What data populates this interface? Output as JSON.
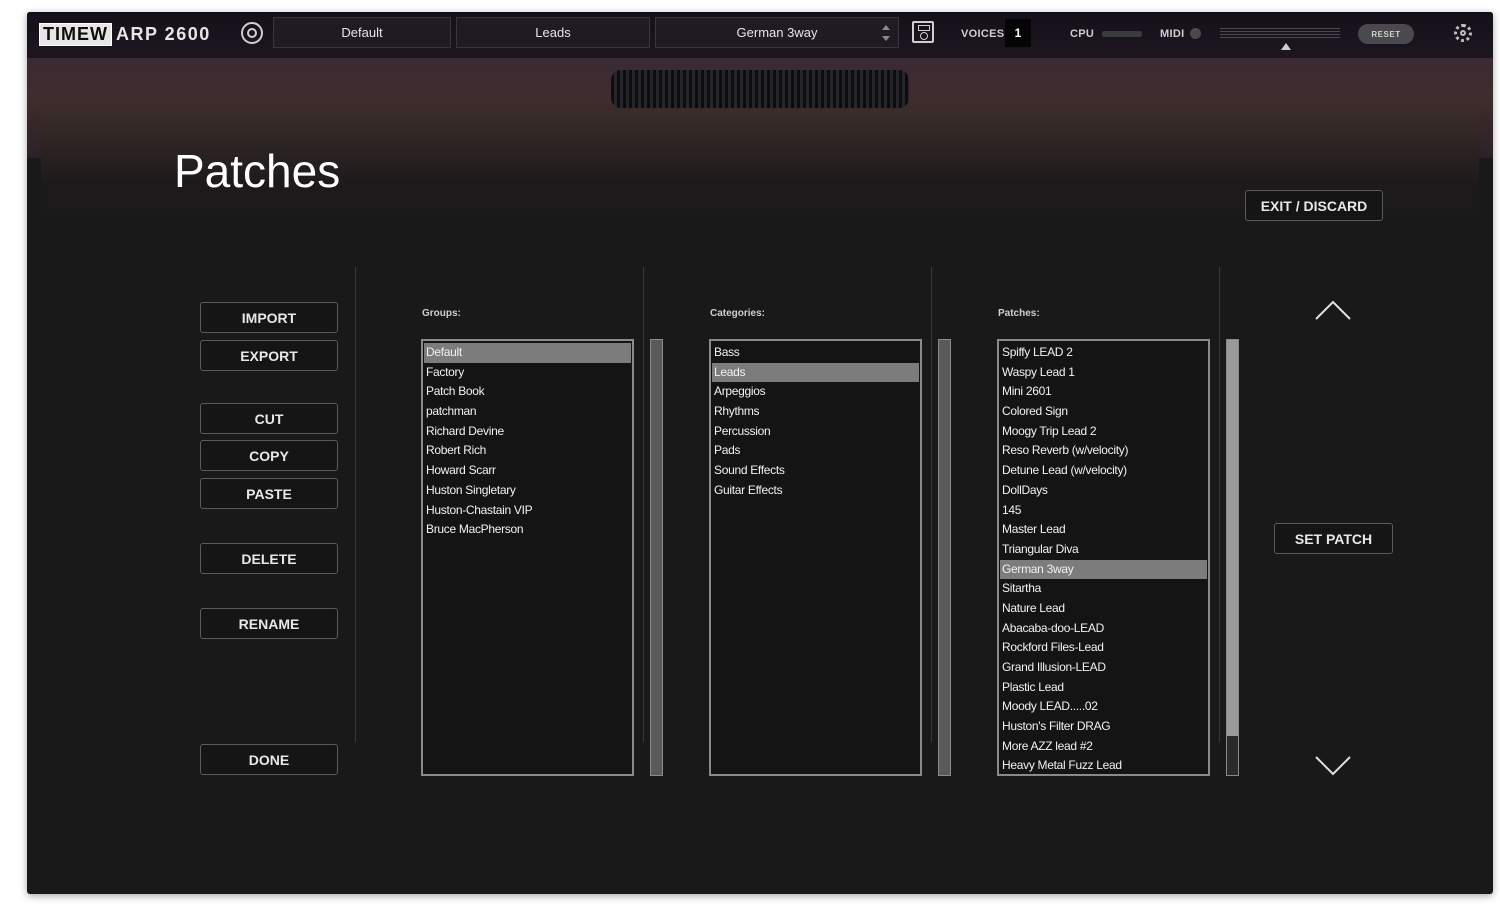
{
  "app": {
    "logo_box": "TIMEW",
    "logo_rest": "ARP 2600"
  },
  "toolbar": {
    "group": "Default",
    "category": "Leads",
    "patch": "German 3way",
    "voices_label": "VOICES",
    "voices_value": "1",
    "cpu_label": "CPU",
    "midi_label": "MIDI",
    "reset_label": "RESET"
  },
  "page": {
    "title": "Patches",
    "exit_label": "EXIT / DISCARD"
  },
  "actions": {
    "import": "IMPORT",
    "export": "EXPORT",
    "cut": "CUT",
    "copy": "COPY",
    "paste": "PASTE",
    "delete": "DELETE",
    "rename": "RENAME",
    "done": "DONE",
    "set_patch": "SET PATCH"
  },
  "groups": {
    "label": "Groups:",
    "selected": "Default",
    "items": [
      "Default",
      "Factory",
      "Patch Book",
      "patchman",
      "Richard Devine",
      "Robert Rich",
      "Howard Scarr",
      "Huston Singletary",
      "Huston-Chastain VIP",
      "Bruce MacPherson"
    ]
  },
  "categories": {
    "label": "Categories:",
    "selected": "Leads",
    "items": [
      "Bass",
      "Leads",
      "Arpeggios",
      "Rhythms",
      "Percussion",
      "Pads",
      "Sound Effects",
      "Guitar Effects"
    ]
  },
  "patches": {
    "label": "Patches:",
    "selected": "German 3way",
    "items": [
      "Spiffy LEAD 2",
      "Waspy Lead 1",
      "Mini 2601",
      "Colored Sign",
      "Moogy Trip Lead 2",
      "Reso Reverb (w/velocity)",
      "Detune Lead (w/velocity)",
      "DollDays",
      "145",
      "Master Lead",
      "Triangular Diva",
      "German 3way",
      "Sitartha",
      "Nature Lead",
      "Abacaba-doo-LEAD",
      "Rockford Files-Lead",
      "Grand Illusion-LEAD",
      "Plastic Lead",
      "Moody LEAD.....02",
      "Huston's Filter DRAG",
      "More AZZ lead #2",
      "Heavy Metal Fuzz Lead"
    ],
    "scroll_fraction": 0.91
  },
  "colors": {
    "background": "#191919",
    "selection": "#7c7c7c",
    "text": "#f2f2f2"
  }
}
